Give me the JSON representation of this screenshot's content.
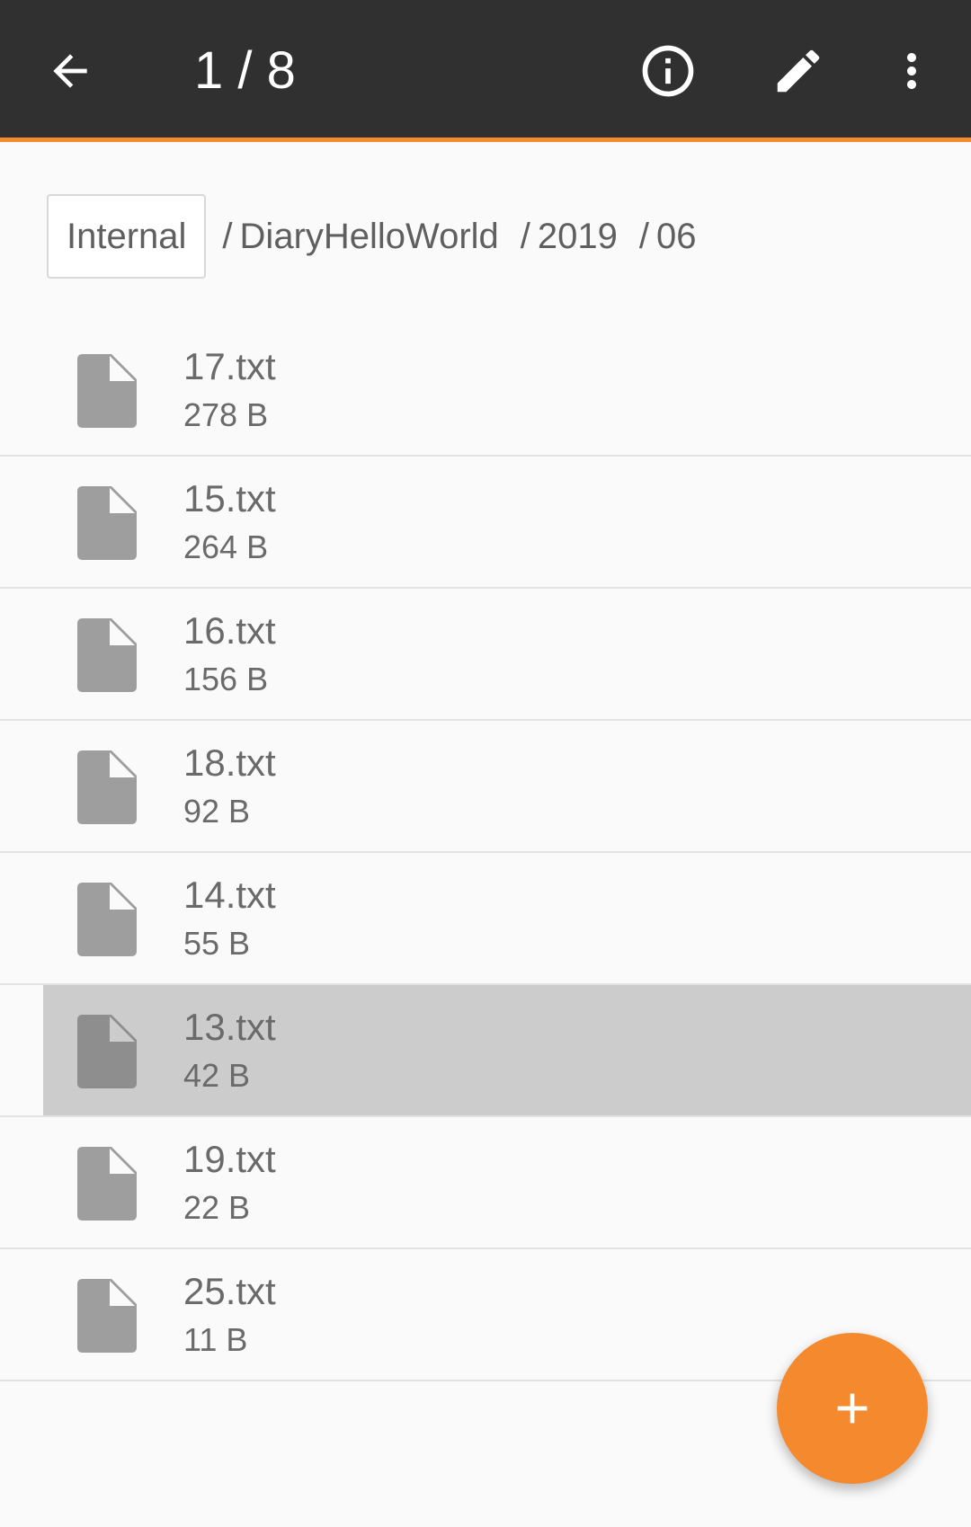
{
  "toolbar": {
    "title": "1 / 8",
    "back_icon": "arrow-back-icon",
    "info_icon": "info-icon",
    "edit_icon": "pencil-icon",
    "more_icon": "more-vertical-icon",
    "background_color": "#303030",
    "accent_color": "#f5892e"
  },
  "breadcrumb": {
    "root": "Internal",
    "separator": "/",
    "segments": [
      "DiaryHelloWorld",
      "2019",
      "06"
    ]
  },
  "files": [
    {
      "name": "17.txt",
      "size": "278 B"
    },
    {
      "name": "15.txt",
      "size": "264 B"
    },
    {
      "name": "16.txt",
      "size": "156 B"
    },
    {
      "name": "18.txt",
      "size": "92 B"
    },
    {
      "name": "14.txt",
      "size": "55 B"
    },
    {
      "name": "13.txt",
      "size": "42 B",
      "selected": true
    },
    {
      "name": "19.txt",
      "size": "22 B"
    },
    {
      "name": "25.txt",
      "size": "11 B"
    }
  ],
  "file_icon": "file-icon",
  "fab": {
    "icon": "plus-icon",
    "color": "#f5892e"
  }
}
